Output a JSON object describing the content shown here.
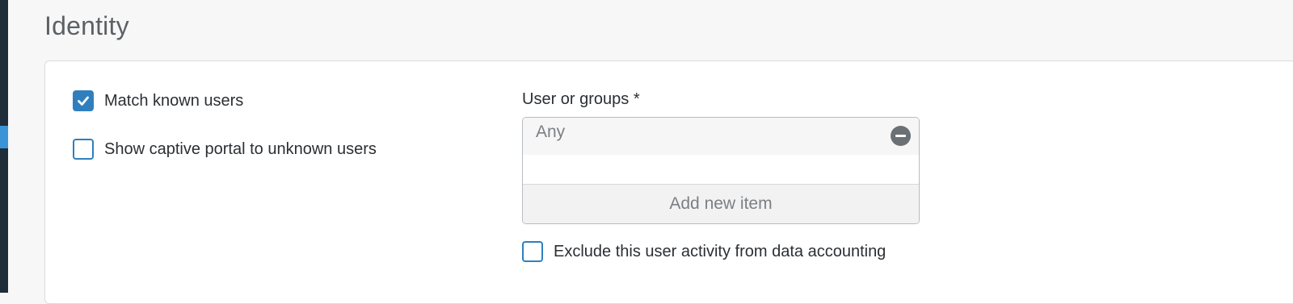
{
  "section": {
    "title": "Identity"
  },
  "options": {
    "match_known_users": {
      "label": "Match known users",
      "checked": true
    },
    "show_captive_portal": {
      "label": "Show captive portal to unknown users",
      "checked": false
    },
    "exclude_data_accounting": {
      "label": "Exclude this user activity from data accounting",
      "checked": false
    }
  },
  "users_field": {
    "label": "User or groups *",
    "items": [
      {
        "label": "Any",
        "remove_icon": "minus-circle-icon"
      }
    ],
    "add_label": "Add new item"
  },
  "colors": {
    "accent": "#2f7fbf",
    "sidebar": "#1f2d3a",
    "sidebar_highlight": "#3b93d8"
  }
}
